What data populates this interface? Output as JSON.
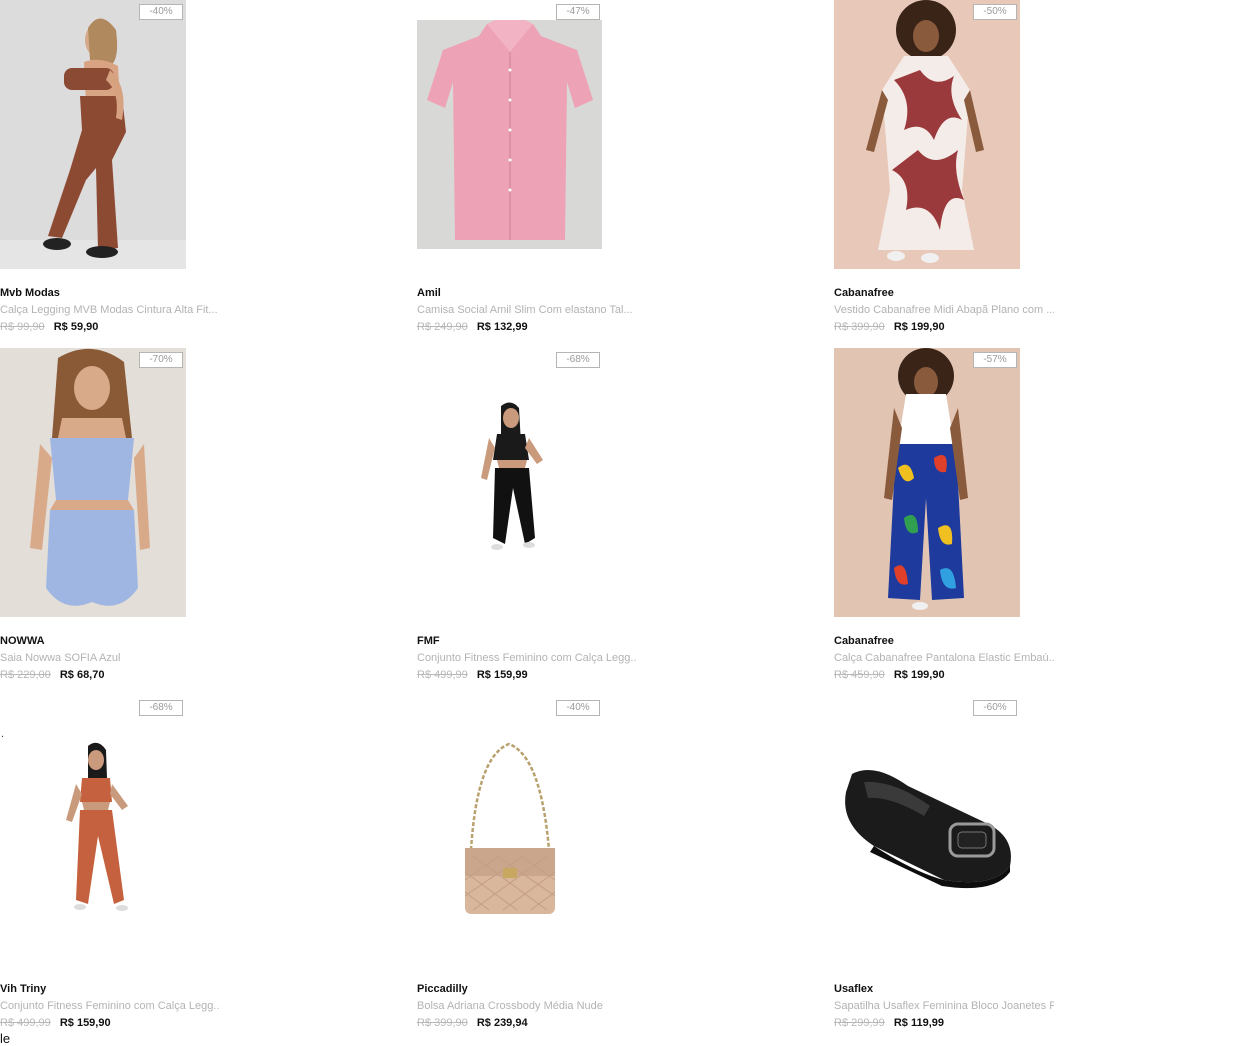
{
  "products": [
    {
      "discount": "-40%",
      "brand": "Mvb Modas",
      "name": "Calça Legging MVB Modas Cintura Alta Fit...",
      "old_price": "R$ 99,90",
      "price": "R$ 59,90",
      "image": "woman-brown-leggings-set"
    },
    {
      "discount": "-47%",
      "brand": "Amil",
      "name": "Camisa Social Amil Slim Com elastano Tal...",
      "old_price": "R$ 249,90",
      "price": "R$ 132,99",
      "image": "pink-dress-shirt"
    },
    {
      "discount": "-50%",
      "brand": "Cabanafree",
      "name": "Vestido Cabanafree Midi Abapã Plano com ...",
      "old_price": "R$ 399,90",
      "price": "R$ 199,90",
      "image": "woman-print-midi-dress"
    },
    {
      "discount": "-70%",
      "brand": "NOWWA",
      "name": "Saia Nowwa SOFIA Azul",
      "old_price": "R$ 229,00",
      "price": "R$ 68,70",
      "image": "woman-blue-skirt-set"
    },
    {
      "discount": "-68%",
      "brand": "FMF",
      "name": "Conjunto Fitness Feminino com Calça Legg...",
      "old_price": "R$ 499,99",
      "price": "R$ 159,99",
      "image": "woman-black-fitness-set"
    },
    {
      "discount": "-57%",
      "brand": "Cabanafree",
      "name": "Calça Cabanafree Pantalona Elastic Embaú...",
      "old_price": "R$ 459,90",
      "price": "R$ 199,90",
      "image": "woman-print-wide-pants"
    },
    {
      "discount": "-68%",
      "brand": "Vih Triny",
      "name": "Conjunto Fitness Feminino com Calça Legg...",
      "old_price": "R$ 499,99",
      "price": "R$ 159,90",
      "image": "woman-terracotta-fitness-set"
    },
    {
      "discount": "-40%",
      "brand": "Piccadilly",
      "name": "Bolsa Adriana Crossbody Média Nude",
      "old_price": "R$ 399,90",
      "price": "R$ 239,94",
      "image": "nude-quilted-handbag"
    },
    {
      "discount": "-60%",
      "brand": "Usaflex",
      "name": "Sapatilha Usaflex Feminina Bloco Joanetes Preto",
      "old_price": "R$ 299,99",
      "price": "R$ 119,99",
      "image": "black-flat-shoe"
    }
  ],
  "stray": {
    "dot": ".",
    "footer": "le"
  },
  "colors": {
    "badge_border": "#b5b5b5",
    "muted_text": "#b3b3b3",
    "strike_price": "#b8b8b8",
    "price": "#111111"
  }
}
